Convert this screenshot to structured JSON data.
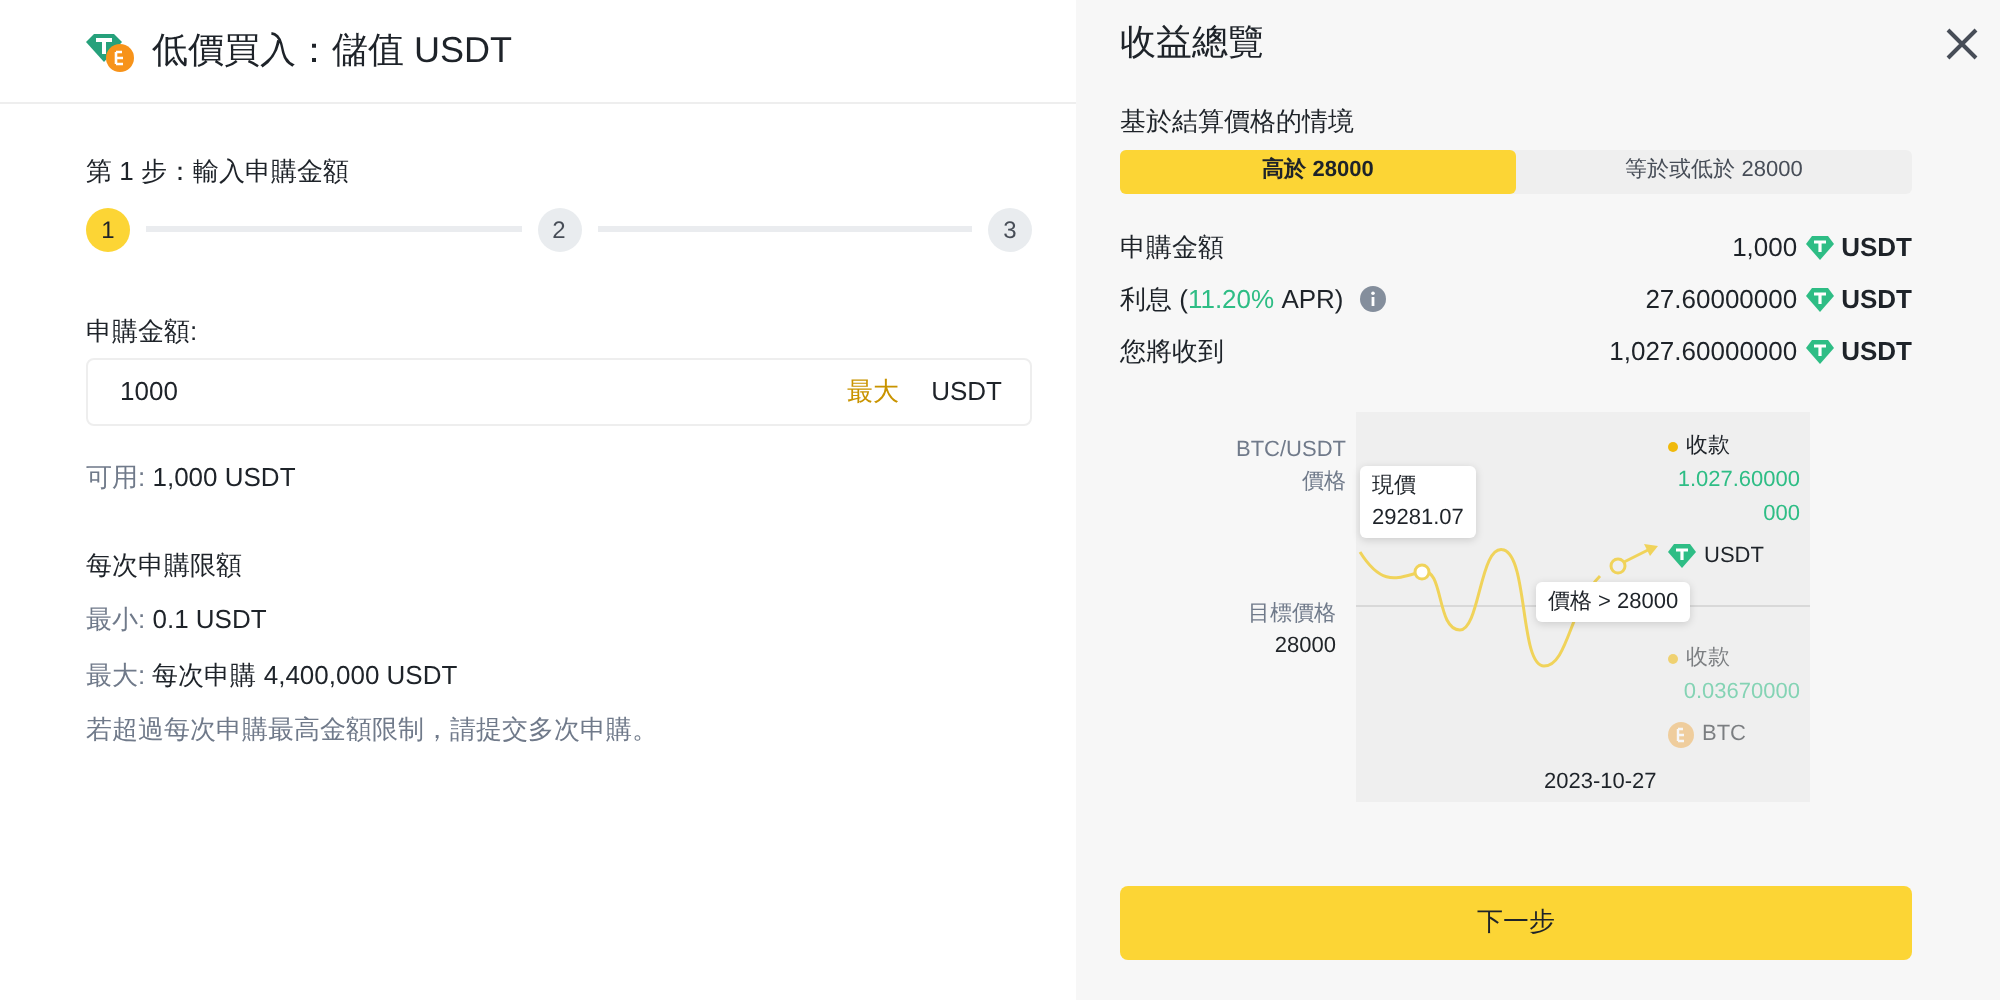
{
  "header": {
    "title": "低價買入：儲值 USDT"
  },
  "step": {
    "label": "第 1 步：輸入申購金額",
    "steps": [
      {
        "number": "1",
        "selected": true
      },
      {
        "number": "2",
        "selected": false
      },
      {
        "number": "3",
        "selected": false
      }
    ]
  },
  "amount": {
    "label": "申購金額:",
    "value": "1000",
    "max_button": "最大",
    "unit": "USDT",
    "available_label": "可用:",
    "available_value": "1,000 USDT"
  },
  "limits": {
    "title": "每次申購限額",
    "items": [
      {
        "label": "最小:",
        "value": "0.1 USDT"
      },
      {
        "label": "最大:",
        "value": "每次申購 4,400,000 USDT"
      }
    ],
    "note": "若超過每次申購最高金額限制，請提交多次申購。"
  },
  "summary": {
    "title": "收益總覽",
    "scenario_label": "基於結算價格的情境",
    "tabs": [
      {
        "label": "高於 28000",
        "selected": true
      },
      {
        "label": "等於或低於 28000",
        "selected": false
      }
    ],
    "rows": [
      {
        "kind": "plain",
        "label": "申購金額",
        "value": "1,000",
        "unit": "USDT"
      },
      {
        "kind": "rate",
        "label": "利息 (",
        "rate": "11.20%",
        "label_end": " APR)",
        "value": "27.60000000",
        "unit": "USDT"
      },
      {
        "kind": "plain",
        "label": "您將收到",
        "value": "1,027.60000000",
        "unit": "USDT"
      }
    ],
    "chart": {
      "y_label": [
        "BTC/USDT",
        "價格"
      ],
      "current_label": "現價",
      "current_value": "29281.07",
      "target_label": "目標價格",
      "target_value": "28000",
      "condition": "價格 > 28000",
      "date": "2023-10-27",
      "outcomes": [
        {
          "label": "收款",
          "amount": "1.027.60000000",
          "currency": "USDT",
          "kind": "tether",
          "selected": true
        },
        {
          "label": "收款",
          "amount": "0.03670000",
          "currency": "BTC",
          "kind": "bitcoin",
          "selected": false
        }
      ]
    },
    "next_button": "下一步"
  }
}
